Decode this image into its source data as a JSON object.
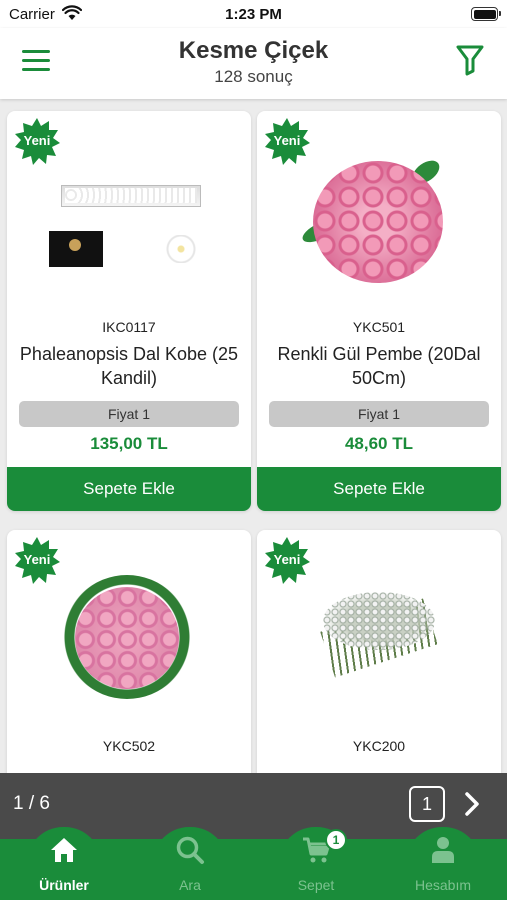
{
  "status_bar": {
    "carrier": "Carrier",
    "time": "1:23 PM"
  },
  "header": {
    "title": "Kesme Çiçek",
    "subtitle": "128 sonuç"
  },
  "colors": {
    "brand_green": "#1a8c3a",
    "pager_bg": "#4a4a4a",
    "price_pill": "#c8c8c8"
  },
  "products": [
    {
      "badge": "Yeni",
      "sku": "IKC0117",
      "name": "Phaleanopsis Dal Kobe (25 Kandil)",
      "price_label": "Fiyat 1",
      "price": "135,00 TL",
      "button": "Sepete Ekle",
      "image": "orchid-box-photo"
    },
    {
      "badge": "Yeni",
      "sku": "YKC501",
      "name": "Renkli Gül Pembe (20Dal 50Cm)",
      "price_label": "Fiyat 1",
      "price": "48,60 TL",
      "button": "Sepete Ekle",
      "image": "pink-roses-photo"
    },
    {
      "badge": "Yeni",
      "sku": "YKC502",
      "image": "pink-rose-bouquet-photo"
    },
    {
      "badge": "Yeni",
      "sku": "YKC200",
      "image": "white-limonium-photo"
    }
  ],
  "pager": {
    "text": "1 / 6",
    "current": "1"
  },
  "tabs": [
    {
      "label": "Ürünler",
      "icon": "home-icon",
      "active": true
    },
    {
      "label": "Ara",
      "icon": "search-icon",
      "active": false
    },
    {
      "label": "Sepet",
      "icon": "cart-icon",
      "active": false,
      "badge": "1"
    },
    {
      "label": "Hesabım",
      "icon": "user-icon",
      "active": false
    }
  ]
}
